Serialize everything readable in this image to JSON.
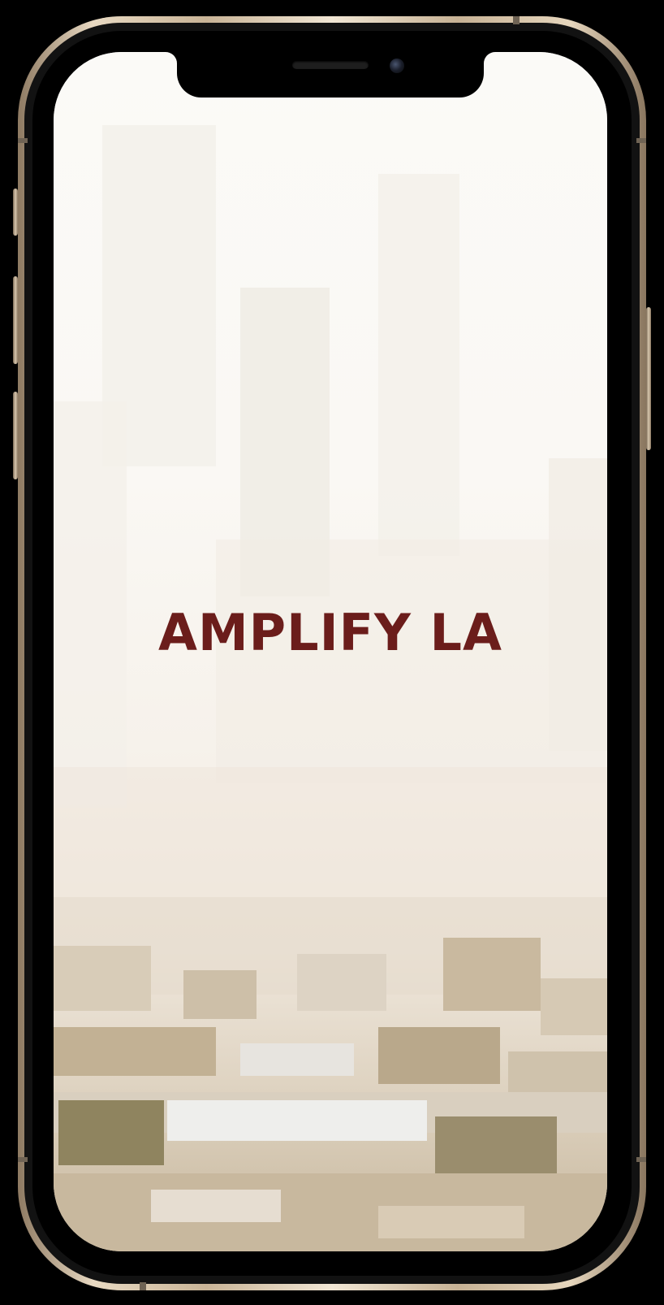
{
  "app": {
    "title": "AMPLIFY LA"
  },
  "device": {
    "frame_color": "#d9c7aa"
  },
  "colors": {
    "title_color": "#6b1d1b",
    "background": "#f9f7f3"
  }
}
